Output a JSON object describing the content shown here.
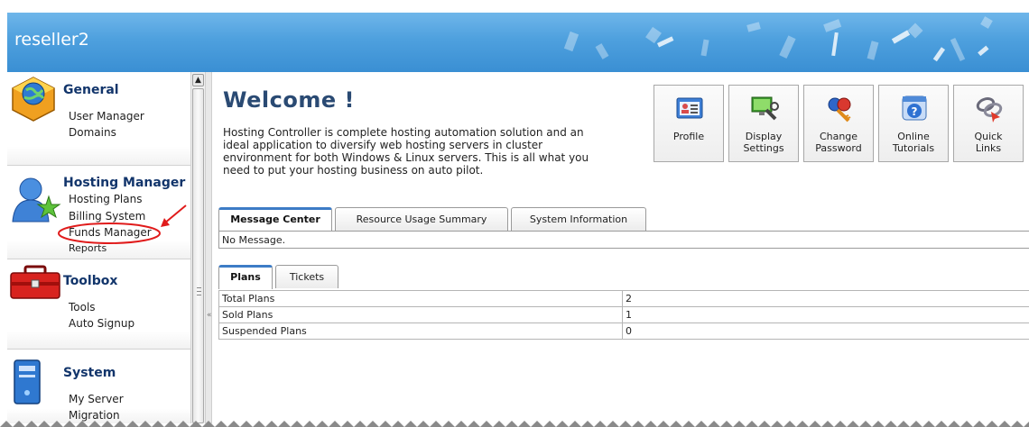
{
  "header": {
    "title": "reseller2"
  },
  "sidebar": {
    "sections": [
      {
        "title": "General",
        "icon": "globe-package-icon",
        "items": [
          "User Manager",
          "Domains"
        ]
      },
      {
        "title": "Hosting Manager",
        "icon": "users-star-icon",
        "items": [
          "Hosting Plans",
          "Billing System",
          "Funds Manager",
          "Reports"
        ]
      },
      {
        "title": "Toolbox",
        "icon": "toolbox-icon",
        "items": [
          "Tools",
          "Auto Signup"
        ]
      },
      {
        "title": "System",
        "icon": "server-icon",
        "items": [
          "My Server",
          "Migration"
        ]
      }
    ],
    "highlighted_item": "Funds Manager",
    "highlight_color": "#e01b1b"
  },
  "main": {
    "welcome_title": "Welcome !",
    "intro_text": "Hosting Controller is complete hosting automation solution and an ideal application to diversify web hosting servers in cluster environment for both Windows & Linux servers. This is all what you need to put your hosting business on auto pilot.",
    "quick_buttons": [
      {
        "label": "Profile",
        "icon": "profile-card-icon"
      },
      {
        "label": "Display\nSettings",
        "icon": "display-settings-icon"
      },
      {
        "label": "Change\nPassword",
        "icon": "change-password-icon"
      },
      {
        "label": "Online\nTutorials",
        "icon": "help-tutorials-icon"
      },
      {
        "label": "Quick\nLinks",
        "icon": "quick-links-icon"
      }
    ],
    "tabs_top": [
      "Message Center",
      "Resource Usage Summary",
      "System Information"
    ],
    "active_tab_top": "Message Center",
    "message_text": "No Message.",
    "tabs_bottom": [
      "Plans",
      "Tickets"
    ],
    "active_tab_bottom": "Plans",
    "plans_rows": [
      {
        "label": "Total Plans",
        "value": "2"
      },
      {
        "label": "Sold Plans",
        "value": "1"
      },
      {
        "label": "Suspended Plans",
        "value": "0"
      }
    ]
  },
  "colors": {
    "header_blue": "#4ea0de",
    "section_title": "#12356b",
    "tab_accent": "#3d7cc6"
  }
}
